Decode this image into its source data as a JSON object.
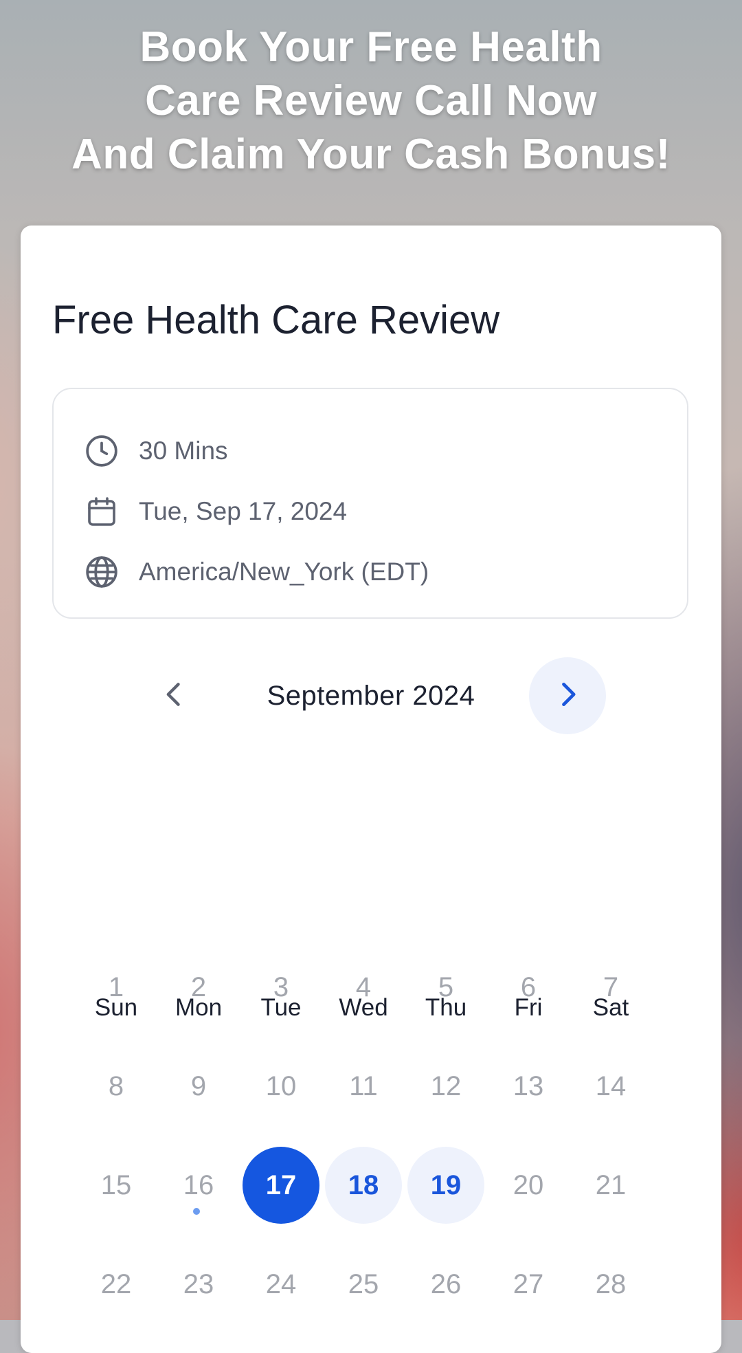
{
  "headline": {
    "line1": "Book Your Free Health",
    "line2": "Care Review Call Now",
    "line3": "And Claim Your Cash Bonus!"
  },
  "event": {
    "title": "Free Health Care Review",
    "duration": "30 Mins",
    "date": "Tue, Sep 17, 2024",
    "timezone": "America/New_York (EDT)"
  },
  "calendar": {
    "month_label": "September 2024",
    "weekdays": [
      "Sun",
      "Mon",
      "Tue",
      "Wed",
      "Thu",
      "Fri",
      "Sat"
    ],
    "weeks": [
      [
        "1",
        "2",
        "3",
        "4",
        "5",
        "6",
        "7"
      ],
      [
        "8",
        "9",
        "10",
        "11",
        "12",
        "13",
        "14"
      ],
      [
        "15",
        "16",
        "17",
        "18",
        "19",
        "20",
        "21"
      ],
      [
        "22",
        "23",
        "24",
        "25",
        "26",
        "27",
        "28"
      ]
    ],
    "selected_day": "17",
    "available_days": [
      "18",
      "19"
    ],
    "today_marker_day": "16"
  },
  "colors": {
    "accent": "#1557e0",
    "available_bg": "#eef2fc",
    "muted_day": "#a3a6ad",
    "title_text": "#1c2130"
  },
  "icons": {
    "duration": "clock-icon",
    "date": "calendar-icon",
    "timezone": "globe-icon",
    "prev": "chevron-left-icon",
    "next": "chevron-right-icon"
  }
}
